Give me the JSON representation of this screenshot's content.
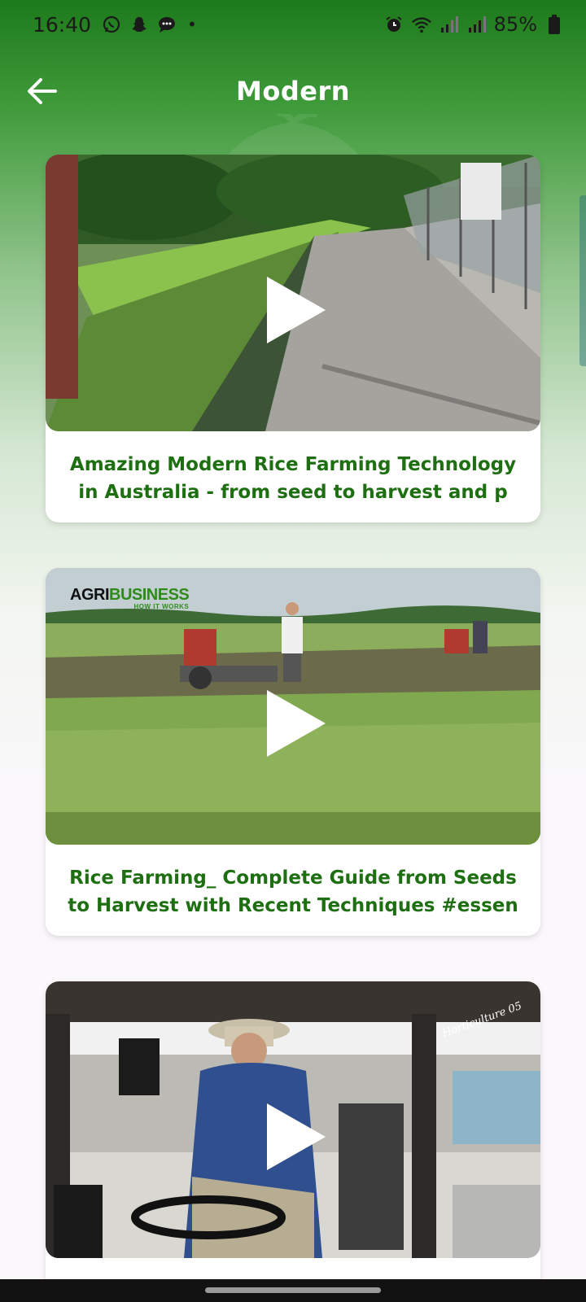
{
  "status_bar": {
    "time": "16:40",
    "battery": "85%",
    "left_icons": [
      "whatsapp-icon",
      "snapchat-icon",
      "messages-icon",
      "dot"
    ],
    "right_icons": [
      "alarm-icon",
      "wifi-icon",
      "signal-icon",
      "signal-icon",
      "battery-icon"
    ]
  },
  "app_bar": {
    "title": "Modern",
    "back_icon": "arrow-left-icon"
  },
  "videos": [
    {
      "title": "Amazing Modern Rice Farming Technology in Australia - from seed to harvest and p",
      "thumbnail": "rice-field-path-with-fence"
    },
    {
      "title": "Rice Farming_ Complete Guide from Seeds to Harvest with Recent Techniques #essen",
      "thumbnail": "farmers-with-hand-tractors-in-rice-field",
      "logo": {
        "part1": "AGRI",
        "part2": "BUSINESS",
        "tagline": "HOW IT WORKS"
      }
    },
    {
      "title": "",
      "thumbnail": "man-in-tractor-cab",
      "logo": {
        "text": "Horticulture 05"
      }
    }
  ],
  "colors": {
    "accent": "#1e6f12",
    "header_green": "#1d7a1a"
  }
}
